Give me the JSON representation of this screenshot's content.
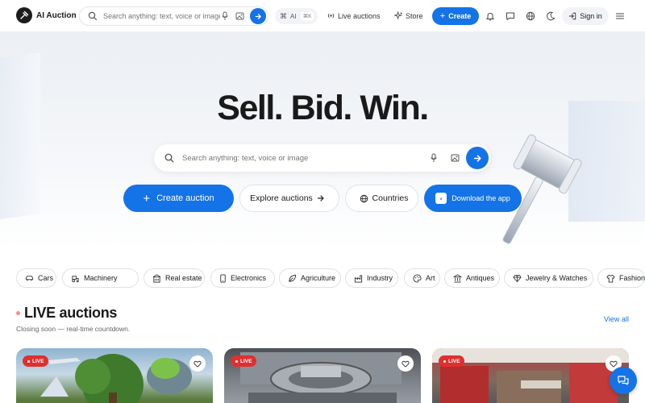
{
  "header": {
    "logo_text": "AI Auction",
    "search_placeholder": "Search anything: text, voice or image",
    "ai_label": "AI",
    "ai_shortcut": "⌘K",
    "live_auctions": "Live auctions",
    "store": "Store",
    "create": "Create",
    "sign_in": "Sign in"
  },
  "hero": {
    "title": "Sell. Bid. Win.",
    "search_placeholder": "Search anything: text, voice or image",
    "create_auction": "Create auction",
    "explore_auctions": "Explore auctions",
    "countries": "Countries",
    "download_app": "Download the app"
  },
  "categories": [
    {
      "label": "Cars",
      "icon": "car-icon"
    },
    {
      "label": "Machinery",
      "icon": "tractor-icon"
    },
    {
      "label": "Real estate",
      "icon": "building-icon"
    },
    {
      "label": "Electronics",
      "icon": "phone-icon"
    },
    {
      "label": "Agriculture",
      "icon": "leaf-icon"
    },
    {
      "label": "Industry",
      "icon": "factory-icon"
    },
    {
      "label": "Art",
      "icon": "palette-icon"
    },
    {
      "label": "Antiques",
      "icon": "landmark-icon"
    },
    {
      "label": "Jewelry & Watches",
      "icon": "gem-icon"
    },
    {
      "label": "Fashion",
      "icon": "shirt-icon"
    }
  ],
  "live": {
    "title": "LIVE auctions",
    "subtitle": "Closing soon — real-time countdown.",
    "view_all": "View all",
    "badge": "LIVE"
  },
  "colors": {
    "accent": "#1473e6",
    "live_badge": "#e02f2f"
  }
}
